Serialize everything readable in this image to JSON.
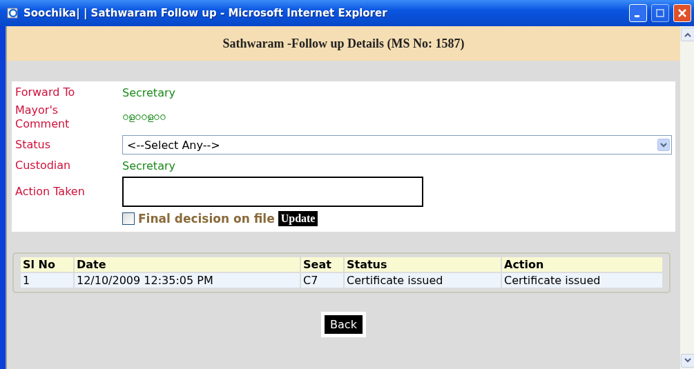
{
  "window": {
    "title": "Soochika| | Sathwaram Follow up - Microsoft Internet Explorer"
  },
  "header": {
    "title": "Sathwaram -Follow up Details (MS No: 1587)"
  },
  "form": {
    "fields": [
      {
        "kind": "text",
        "label": "Forward To",
        "value": "Secretary"
      },
      {
        "kind": "comment",
        "label": "Mayor's Comment",
        "value": "ഠളഠഠളഠഠ"
      },
      {
        "kind": "select",
        "label": "Status",
        "value": "<--Select Any-->"
      },
      {
        "kind": "text",
        "label": "Custodian",
        "value": "Secretary"
      },
      {
        "kind": "textarea",
        "label": "Action Taken"
      }
    ],
    "final_decision": {
      "label": "Final decision on file",
      "checked": false
    },
    "update_button": "Update"
  },
  "table": {
    "columns": [
      "Sl No",
      "Date",
      "Seat",
      "Status",
      "Action"
    ],
    "rows": [
      [
        "1",
        "12/10/2009 12:35:05 PM",
        "C7",
        "Certificate issued",
        "Certificate issued"
      ]
    ]
  },
  "back_button": "Back"
}
